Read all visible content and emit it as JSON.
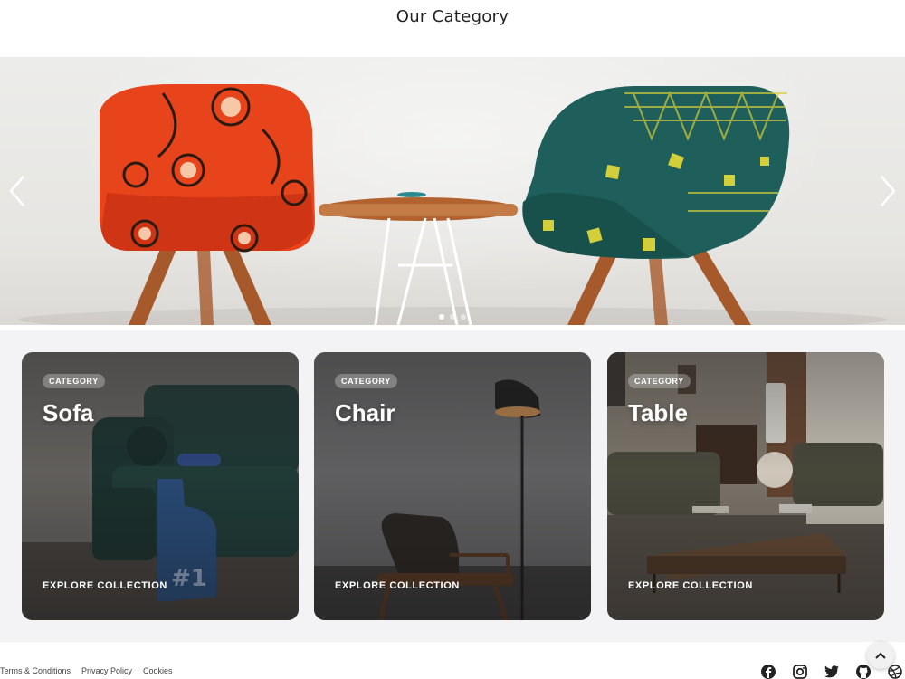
{
  "page": {
    "title": "Our Category"
  },
  "carousel": {
    "prev_icon": "chevron-left-icon",
    "next_icon": "chevron-right-icon",
    "slides": 3,
    "active_slide": 1
  },
  "categories": [
    {
      "badge": "CATEGORY",
      "title": "Sofa",
      "cta": "EXPLORE COLLECTION"
    },
    {
      "badge": "CATEGORY",
      "title": "Chair",
      "cta": "EXPLORE COLLECTION"
    },
    {
      "badge": "CATEGORY",
      "title": "Table",
      "cta": "EXPLORE COLLECTION"
    }
  ],
  "footer": {
    "links": [
      "Terms & Conditions",
      "Privacy Policy",
      "Cookies"
    ],
    "social": [
      "facebook-icon",
      "instagram-icon",
      "twitter-icon",
      "github-icon",
      "dribbble-icon"
    ],
    "back_to_top_icon": "chevron-up-icon"
  },
  "colors": {
    "hero_wall": "#ececea",
    "chair_left": "#e8441c",
    "chair_right": "#1f5f5b",
    "wood": "#a65a2c",
    "section_bg": "#f3f3f5"
  }
}
